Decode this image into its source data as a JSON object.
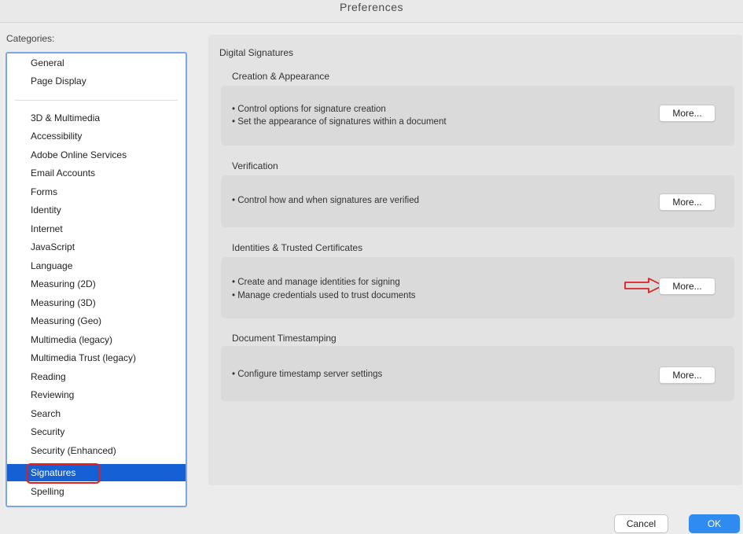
{
  "window": {
    "title": "Preferences"
  },
  "sidebar": {
    "label": "Categories:",
    "items_top": [
      "General",
      "Page Display"
    ],
    "items": [
      "3D & Multimedia",
      "Accessibility",
      "Adobe Online Services",
      "Email Accounts",
      "Forms",
      "Identity",
      "Internet",
      "JavaScript",
      "Language",
      "Measuring (2D)",
      "Measuring (3D)",
      "Measuring (Geo)",
      "Multimedia (legacy)",
      "Multimedia Trust (legacy)",
      "Reading",
      "Reviewing",
      "Search",
      "Security",
      "Security (Enhanced)",
      "Signatures",
      "Spelling"
    ],
    "selected": "Signatures"
  },
  "main": {
    "heading": "Digital Signatures",
    "sections": [
      {
        "title": "Creation & Appearance",
        "lines": [
          "• Control options for signature creation",
          "• Set the appearance of signatures within a document"
        ],
        "button": "More..."
      },
      {
        "title": "Verification",
        "lines": [
          "• Control how and when signatures are verified"
        ],
        "button": "More..."
      },
      {
        "title": "Identities & Trusted Certificates",
        "lines": [
          "• Create and manage identities for signing",
          "• Manage credentials used to trust documents"
        ],
        "button": "More..."
      },
      {
        "title": "Document Timestamping",
        "lines": [
          "• Configure timestamp server settings"
        ],
        "button": "More..."
      }
    ]
  },
  "footer": {
    "cancel": "Cancel",
    "ok": "OK"
  },
  "colors": {
    "selection": "#1560d4",
    "annotation": "#e02020",
    "ok_button": "#2f8bef"
  },
  "icons": {
    "annotation_arrow": "right-arrow-outline-icon"
  }
}
